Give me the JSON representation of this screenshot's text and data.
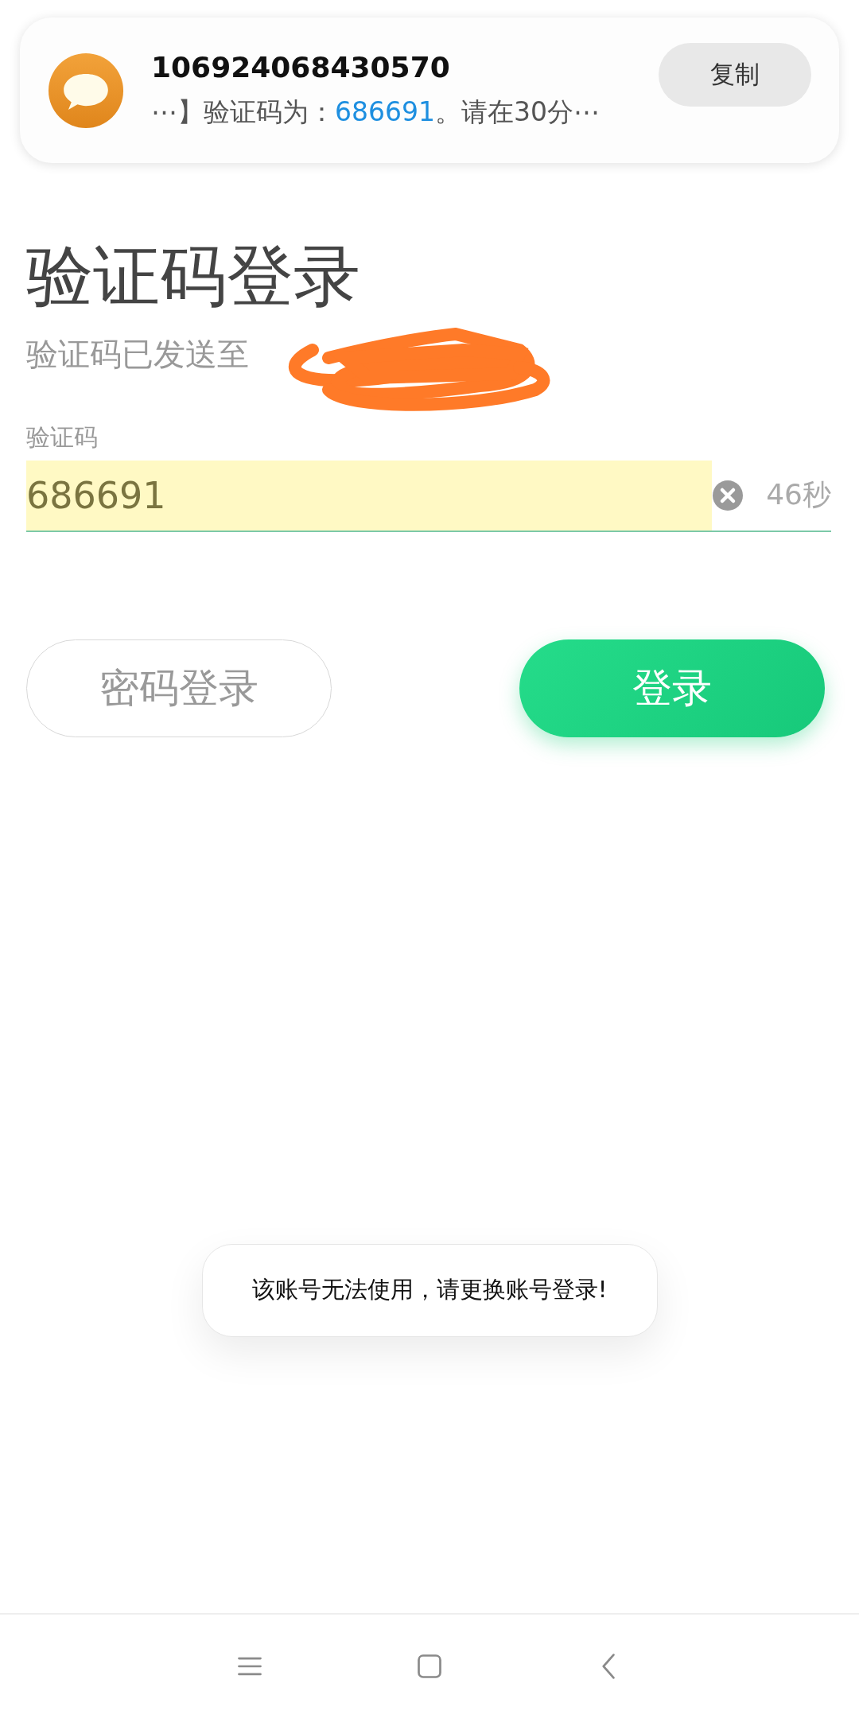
{
  "notification": {
    "sender": "106924068430570",
    "message": {
      "prefix": "⋯】验证码为：",
      "code": "686691",
      "suffix": "。请在30分⋯"
    },
    "copy_button": "复制"
  },
  "title": "验证码登录",
  "subtitle": {
    "text": "验证码已发送至",
    "redacted": true
  },
  "code_field": {
    "label": "验证码",
    "value": "686691",
    "autofilled": true,
    "countdown": "46秒"
  },
  "buttons": [
    {
      "label": "密码登录",
      "kind": "secondary"
    },
    {
      "label": "登录",
      "kind": "primary"
    }
  ],
  "toast": "该账号无法使用，请更换账号登录!"
}
